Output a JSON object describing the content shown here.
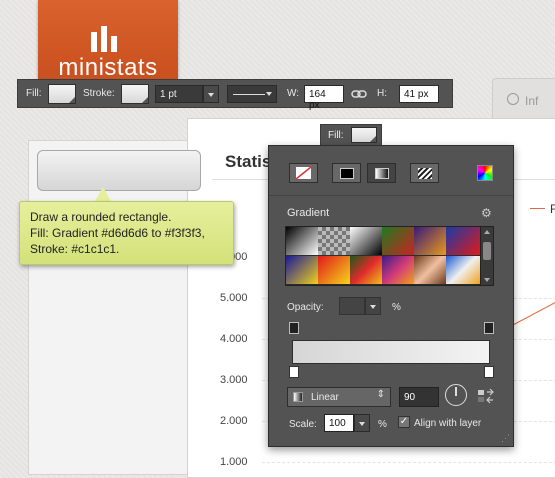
{
  "app": {
    "logo_text": "ministats",
    "tab_info_label": "Inf",
    "stats_title": "Statis",
    "legend_partial": "F"
  },
  "chart_axis": {
    "y_labels": [
      "5.000",
      "4.000",
      "3.000",
      "2.000",
      "1.000"
    ],
    "partial_top_label": "000"
  },
  "tooltip": {
    "line1": "Draw a rounded rectangle.",
    "line2": "Fill: Gradient #d6d6d6 to #f3f3f3,",
    "line3": "Stroke: #c1c1c1."
  },
  "toolbar": {
    "fill_label": "Fill:",
    "stroke_label": "Stroke:",
    "stroke_weight": "1 pt",
    "width_label": "W:",
    "width_value": "164 px",
    "height_label": "H:",
    "height_value": "41 px"
  },
  "fill_chip": {
    "label": "Fill:"
  },
  "gradient_panel": {
    "section_title": "Gradient",
    "opacity_label": "Opacity:",
    "opacity_value": "",
    "opacity_unit": "%",
    "type_value": "Linear",
    "angle_value": "90",
    "scale_label": "Scale:",
    "scale_value": "100",
    "scale_unit": "%",
    "align_label": "Align with layer",
    "align_checked": true
  },
  "colors": {
    "brand_orange": "#d65c28",
    "tooltip_yellow": "#dde88a",
    "gradient_start": "#d6d6d6",
    "gradient_end": "#f3f3f3",
    "stroke": "#c1c1c1",
    "panel_bg": "#535353"
  },
  "icons": {
    "tab_info": "info-icon",
    "link": "link-icon",
    "gear": "gear-icon",
    "color_picker": "color-picker-icon",
    "angle_dial": "angle-dial-icon",
    "reverse": "reverse-gradient-icon",
    "resize": "resize-grip-icon"
  }
}
